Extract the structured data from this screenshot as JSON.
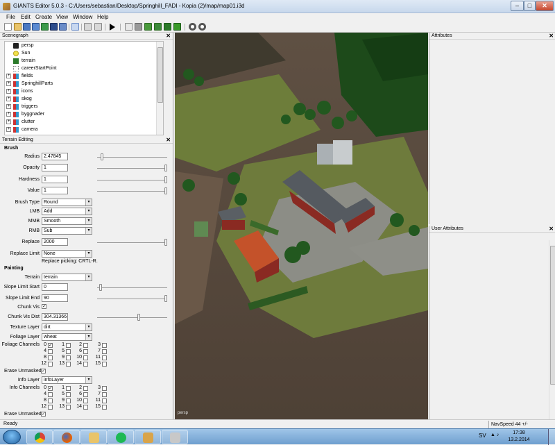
{
  "window": {
    "title": "GIANTS Editor 5.0.3 - C:/Users/sebastian/Desktop/Springhill_FADI - Kopia (2)/map/map01.i3d",
    "min": "–",
    "max": "□",
    "close": "✕"
  },
  "menu": [
    "File",
    "Edit",
    "Create",
    "View",
    "Window",
    "Help"
  ],
  "toolbar_icons": [
    "new-file-icon",
    "open-file-icon",
    "save-icon",
    "save-as-icon",
    "refresh-icon",
    "floppy-icon",
    "import-icon",
    "undo-icon",
    "redo-icon",
    "play-icon",
    "home-icon",
    "move-icon",
    "terrain-sculpt-icon",
    "terrain-paint-icon",
    "foliage-icon",
    "grass-icon",
    "gear-icon",
    "settings-icon"
  ],
  "scenegraph": {
    "title": "Scenegraph",
    "items": [
      {
        "label": "persp",
        "icon": "camera-icon",
        "expandable": false
      },
      {
        "label": "Sun",
        "icon": "light-bulb-icon",
        "expandable": false
      },
      {
        "label": "terrain",
        "icon": "terrain-icon",
        "expandable": false
      },
      {
        "label": "careerStartPoint",
        "icon": "transform-icon",
        "expandable": false
      },
      {
        "label": "fields",
        "icon": "group-icon",
        "expandable": true
      },
      {
        "label": "SpringhillParts",
        "icon": "group-icon",
        "expandable": true
      },
      {
        "label": "icons",
        "icon": "group-icon",
        "expandable": true
      },
      {
        "label": "skog",
        "icon": "group-icon",
        "expandable": true
      },
      {
        "label": "triggers",
        "icon": "group-icon",
        "expandable": true
      },
      {
        "label": "byggnader",
        "icon": "group-icon",
        "expandable": true
      },
      {
        "label": "clutter",
        "icon": "group-icon",
        "expandable": true
      },
      {
        "label": "camera",
        "icon": "group-icon",
        "expandable": true
      }
    ]
  },
  "terrain_editing": {
    "title": "Terrain Editing",
    "brush_title": "Brush",
    "radius_label": "Radius",
    "radius": "2.47845",
    "opacity_label": "Opacity",
    "opacity": "1",
    "hardness_label": "Hardness",
    "hardness": "1",
    "value_label": "Value",
    "value": "1",
    "brush_type_label": "Brush Type",
    "brush_type": "Round",
    "lmb_label": "LMB",
    "lmb": "Add",
    "mmb_label": "MMB",
    "mmb": "Smooth",
    "rmb_label": "RMB",
    "rmb": "Sub",
    "replace_label": "Replace",
    "replace": "2000",
    "replace_limit_label": "Replace Limit",
    "replace_limit": "None",
    "replace_hint": "Replace picking: CRTL-R.",
    "painting_title": "Painting",
    "terrain_label": "Terrain",
    "terrain": "terrain",
    "slope_start_label": "Slope Limit Start",
    "slope_start": "0",
    "slope_end_label": "Slope Limit End",
    "slope_end": "90",
    "chunk_vis_label": "Chunk Vis",
    "chunk_vis_dist_label": "Chunk Vis Dist",
    "chunk_vis_dist": "304.31366",
    "texture_layer_label": "Texture Layer",
    "texture_layer": "dirt",
    "foliage_layer_label": "Foliage Layer",
    "foliage_layer": "wheat",
    "foliage_channels_label": "Foliage Channels",
    "erase_unmasked_label": "Erase Unmasked",
    "info_layer_label": "Info Layer",
    "info_layer": "infoLayer",
    "info_channels_label": "Info Channels",
    "erase_unmasked_label_2": "Erase Unmasked",
    "channel_numbers": [
      "0",
      "1",
      "2",
      "3",
      "4",
      "5",
      "6",
      "7",
      "8",
      "9",
      "10",
      "11",
      "12",
      "13",
      "14",
      "15"
    ],
    "slider_levels": {
      "radius": 0.05,
      "opacity": 1.0,
      "hardness": 1.0,
      "value": 1.0,
      "replace": 1.0,
      "slope_start": 0.03,
      "slope_end": 1.0,
      "chunk_vis_dist": 0.6
    }
  },
  "viewport": {
    "camera_tag": "persp"
  },
  "attributes": {
    "title": "Attributes"
  },
  "user_attributes": {
    "title": "User Attributes"
  },
  "status": {
    "ready": "Ready",
    "navspeed": "NavSpeed 44 +/-"
  },
  "taskbar": {
    "lang": "SV",
    "time": "17:38",
    "date": "13.2.2014"
  }
}
